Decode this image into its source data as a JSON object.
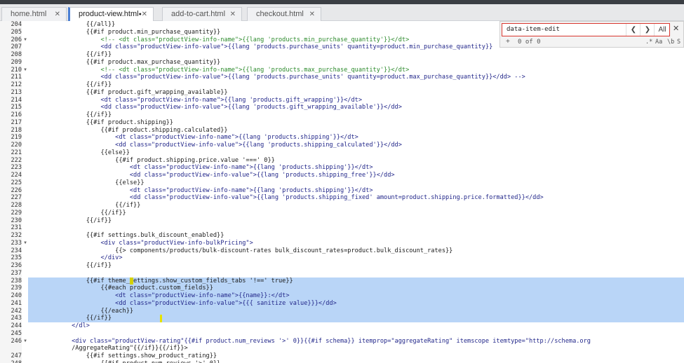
{
  "tabs": [
    {
      "label": "home.html",
      "close": "✕"
    },
    {
      "label": "product-view.html",
      "modified": "●",
      "close": "✕"
    },
    {
      "label": "add-to-cart.html",
      "close": "✕"
    },
    {
      "label": "checkout.html",
      "close": "✕"
    }
  ],
  "find": {
    "query": "data-item-edit",
    "prev": "❮",
    "next": "❯",
    "all": "All",
    "close": "✕",
    "add": "+",
    "count": "0 of 0",
    "regex": ".*",
    "case": "Aa",
    "word": "\\b",
    "selection": "S"
  },
  "code": {
    "lines": [
      {
        "n": "204",
        "text": "                {{/all}}"
      },
      {
        "n": "205",
        "text": "                {{#if product.min_purchase_quantity}}"
      },
      {
        "n": "206",
        "text": "                    <!-- <dt class=\"productView-info-name\">{{lang 'products.min_purchase_quantity'}}</dt>"
      },
      {
        "n": "207",
        "text": "                    <dd class=\"productView-info-value\">{{lang 'products.purchase_units' quantity=product.min_purchase_quantity}}"
      },
      {
        "n": "208",
        "text": "                {{/if}}"
      },
      {
        "n": "209",
        "text": "                {{#if product.max_purchase_quantity}}"
      },
      {
        "n": "210",
        "text": "                    <!-- <dt class=\"productView-info-name\">{{lang 'products.max_purchase_quantity'}}</dt>"
      },
      {
        "n": "211",
        "text": "                    <dd class=\"productView-info-value\">{{lang 'products.purchase_units' quantity=product.max_purchase_quantity}}</dd> -->"
      },
      {
        "n": "212",
        "text": "                {{/if}}"
      },
      {
        "n": "213",
        "text": "                {{#if product.gift_wrapping_available}}"
      },
      {
        "n": "214",
        "text": "                    <dt class=\"productView-info-name\">{{lang 'products.gift_wrapping'}}</dt>"
      },
      {
        "n": "215",
        "text": "                    <dd class=\"productView-info-value\">{{lang 'products.gift_wrapping_available'}}</dd>"
      },
      {
        "n": "216",
        "text": "                {{/if}}"
      },
      {
        "n": "217",
        "text": "                {{#if product.shipping}}"
      },
      {
        "n": "218",
        "text": "                    {{#if product.shipping.calculated}}"
      },
      {
        "n": "219",
        "text": "                        <dt class=\"productView-info-name\">{{lang 'products.shipping'}}</dt>"
      },
      {
        "n": "220",
        "text": "                        <dd class=\"productView-info-value\">{{lang 'products.shipping_calculated'}}</dd>"
      },
      {
        "n": "221",
        "text": "                    {{else}}"
      },
      {
        "n": "222",
        "text": "                        {{#if product.shipping.price.value '===' 0}}"
      },
      {
        "n": "223",
        "text": "                            <dt class=\"productView-info-name\">{{lang 'products.shipping'}}</dt>"
      },
      {
        "n": "224",
        "text": "                            <dd class=\"productView-info-value\">{{lang 'products.shipping_free'}}</dd>"
      },
      {
        "n": "225",
        "text": "                        {{else}}"
      },
      {
        "n": "226",
        "text": "                            <dt class=\"productView-info-name\">{{lang 'products.shipping'}}</dt>"
      },
      {
        "n": "227",
        "text": "                            <dd class=\"productView-info-value\">{{lang 'products.shipping_fixed' amount=product.shipping.price.formatted}}</dd>"
      },
      {
        "n": "228",
        "text": "                        {{/if}}"
      },
      {
        "n": "229",
        "text": "                    {{/if}}"
      },
      {
        "n": "230",
        "text": "                {{/if}}"
      },
      {
        "n": "231",
        "text": ""
      },
      {
        "n": "232",
        "text": "                {{#if settings.bulk_discount_enabled}}"
      },
      {
        "n": "233",
        "text": "                    <div class=\"productView-info-bulkPricing\">"
      },
      {
        "n": "234",
        "text": "                        {{> components/products/bulk-discount-rates bulk_discount_rates=product.bulk_discount_rates}}"
      },
      {
        "n": "235",
        "text": "                    </div>"
      },
      {
        "n": "236",
        "text": "                {{/if}}"
      },
      {
        "n": "237",
        "text": ""
      },
      {
        "n": "238",
        "text": "                {{#if theme_settings.show_custom_fields_tabs '!==' true}}"
      },
      {
        "n": "239",
        "text": "                    {{#each product.custom_fields}}"
      },
      {
        "n": "240",
        "text": "                        <dt class=\"productView-info-name\">{{name}}:</dt>"
      },
      {
        "n": "241",
        "text": "                        <dd class=\"productView-info-value\">{{{ sanitize value}}}</dd>"
      },
      {
        "n": "242",
        "text": "                    {{/each}}"
      },
      {
        "n": "243",
        "text": "                {{/if}}"
      },
      {
        "n": "244",
        "text": "            </dl>"
      },
      {
        "n": "245",
        "text": ""
      },
      {
        "n": "246",
        "text": "            <div class=\"productView-rating\"{{#if product.num_reviews '>' 0}}{{#if schema}} itemprop=\"aggregateRating\" itemscope itemtype=\"http://schema.org"
      },
      {
        "n": "",
        "text": "            /AggregateRating\"{{/if}}{{/if}}>"
      },
      {
        "n": "247",
        "text": "                {{#if settings.show_product_rating}}"
      },
      {
        "n": "248",
        "text": "                    {{#if product.num_reviews '>' 0}}"
      }
    ]
  }
}
